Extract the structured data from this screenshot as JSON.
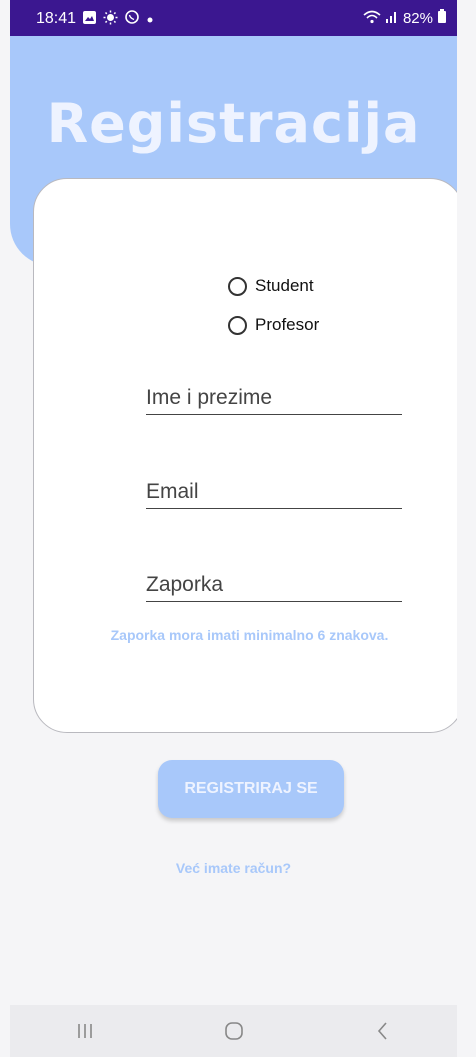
{
  "status_bar": {
    "time": "18:41",
    "battery": "82%"
  },
  "header": {
    "title": "Registracija"
  },
  "form": {
    "radio_options": [
      {
        "label": "Student",
        "selected": false
      },
      {
        "label": "Profesor",
        "selected": false
      }
    ],
    "name_placeholder": "Ime i prezime",
    "name_value": "",
    "email_placeholder": "Email",
    "email_value": "",
    "password_placeholder": "Zaporka",
    "password_value": "",
    "password_hint": "Zaporka mora imati minimalno 6 znakova."
  },
  "actions": {
    "register_label": "REGISTRIRAJ SE",
    "login_link": "Već imate račun?"
  },
  "colors": {
    "accent": "#a8c8fa",
    "status_bar": "#3b1790",
    "background": "#f5f5f7"
  },
  "icons": {
    "status_left": [
      "gallery-icon",
      "brightness-icon",
      "viber-icon",
      "dot-icon"
    ],
    "status_right": [
      "wifi-icon",
      "signal-icon",
      "battery-icon"
    ],
    "nav": [
      "recents-icon",
      "home-icon",
      "back-icon"
    ]
  }
}
